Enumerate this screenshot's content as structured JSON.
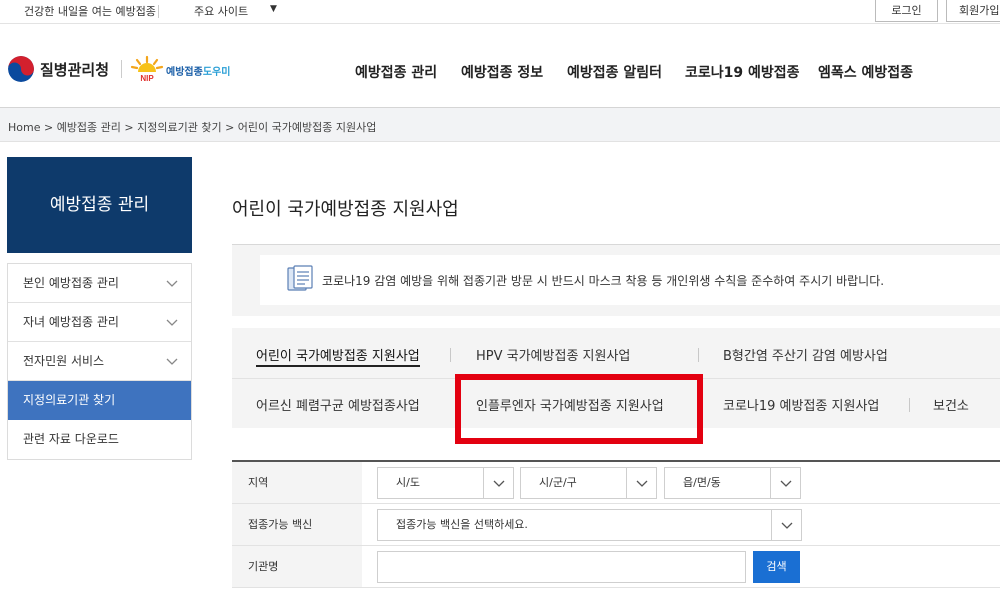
{
  "topbar": {
    "slogan": "건강한 내일을 여는 예방접종",
    "sites_label": "주요 사이트",
    "sites_caret": "▼",
    "login_label": "로그인",
    "join_label": "회원가입"
  },
  "header": {
    "agency_name": "질병관리청",
    "helper_name_main": "예방접종",
    "helper_name_accent": "도우미",
    "nip_badge": "NIP",
    "nav": [
      "예방접종 관리",
      "예방접종 정보",
      "예방접종 알림터",
      "코로나19 예방접종",
      "엠폭스 예방접종"
    ]
  },
  "breadcrumb": "Home  >  예방접종 관리  >  지정의료기관 찾기  >  어린이 국가예방접종 지원사업",
  "sidebar": {
    "title": "예방접종 관리",
    "items": [
      {
        "label": "본인 예방접종 관리",
        "has_chevron": true,
        "active": false
      },
      {
        "label": "자녀 예방접종 관리",
        "has_chevron": true,
        "active": false
      },
      {
        "label": "전자민원 서비스",
        "has_chevron": true,
        "active": false
      },
      {
        "label": "지정의료기관 찾기",
        "has_chevron": false,
        "active": true
      },
      {
        "label": "관련 자료 다운로드",
        "has_chevron": false,
        "active": false
      }
    ]
  },
  "main": {
    "title": "어린이 국가예방접종 지원사업",
    "notice": "코로나19 감염 예방을 위해 접종기관 방문 시 반드시 마스크 착용 등 개인위생 수칙을 준수하여 주시기 바랍니다.",
    "tabs_row1": [
      "어린이 국가예방접종 지원사업",
      "HPV 국가예방접종 지원사업",
      "B형간염 주산기 감염 예방사업"
    ],
    "tabs_row2": [
      "어르신 폐렴구균 예방접종사업",
      "인플루엔자 국가예방접종 지원사업",
      "코로나19 예방접종 지원사업",
      "보건소"
    ],
    "active_tab": "어린이 국가예방접종 지원사업"
  },
  "search": {
    "region_label": "지역",
    "sido": "시/도",
    "sigungu": "시/군/구",
    "dong": "읍/면/동",
    "vaccine_label": "접종가능 백신",
    "vaccine_placeholder": "접종가능 백신을 선택하세요.",
    "org_label": "기관명",
    "org_value": "",
    "search_button": "검색"
  },
  "colors": {
    "primary_navy": "#0e3a6b",
    "active_blue": "#3e73bf",
    "search_blue": "#1a6fd3",
    "highlight_red": "#e30010"
  }
}
